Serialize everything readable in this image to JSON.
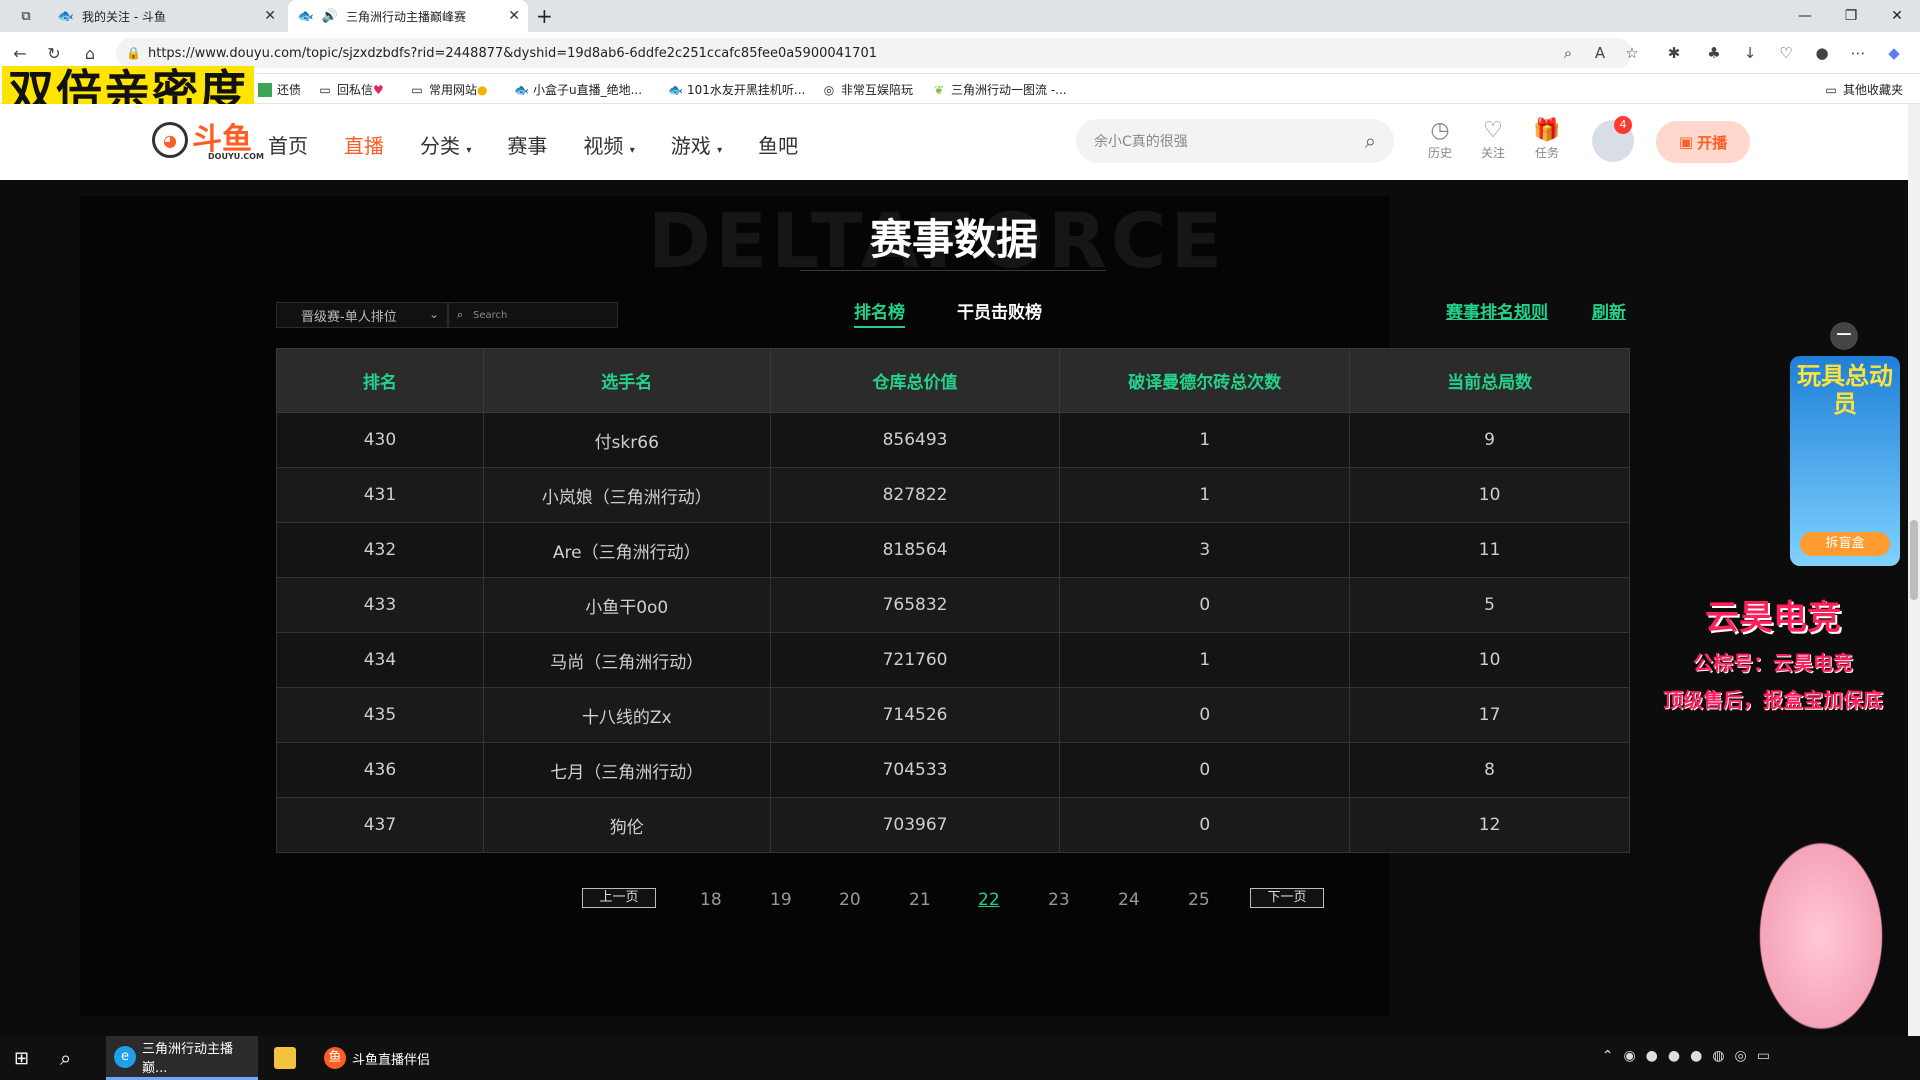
{
  "browser": {
    "tabs": [
      {
        "title": "我的关注 - 斗鱼",
        "active": false
      },
      {
        "title": "三角洲行动主播巅峰赛",
        "active": true
      }
    ],
    "new_tab": "+",
    "url": "https://www.douyu.com/topic/sjzxdzbdfs?rid=2448877&dyshid=19d8ab6-6ddfe2c251ccafc85fee0a5900041701",
    "bookmarks": [
      "还债",
      "回私信",
      "常用网站",
      "小盒子u直播_绝地...",
      "101水友开黑挂机听...",
      "非常互娱陪玩",
      "三角洲行动一图流 -..."
    ],
    "other_bookmarks": "其他收藏夹"
  },
  "overlay_caption": "双倍亲密度",
  "site": {
    "logo_text": "斗鱼",
    "logo_sub": "DOUYU.COM",
    "nav": [
      "首页",
      "直播",
      "分类",
      "赛事",
      "视频",
      "游戏",
      "鱼吧"
    ],
    "nav_active": "直播",
    "search_placeholder": "余小C真的很强",
    "header_icons": [
      "历史",
      "关注",
      "任务"
    ],
    "badge_count": "4",
    "live_button": "开播"
  },
  "page": {
    "bg_text": "DELTAFORCE",
    "title": "赛事数据",
    "filter_select": "晋级赛-单人排位",
    "search_placeholder": "Search",
    "tabs": [
      "排名榜",
      "干员击败榜"
    ],
    "links": [
      "赛事排名规则",
      "刷新"
    ]
  },
  "table": {
    "headers": [
      "排名",
      "选手名",
      "仓库总价值",
      "破译曼德尔砖总次数",
      "当前总局数"
    ],
    "rows": [
      [
        "430",
        "付skr66",
        "856493",
        "1",
        "9"
      ],
      [
        "431",
        "小岚娘（三角洲行动）",
        "827822",
        "1",
        "10"
      ],
      [
        "432",
        "Are（三角洲行动）",
        "818564",
        "3",
        "11"
      ],
      [
        "433",
        "小鱼干0o0",
        "765832",
        "0",
        "5"
      ],
      [
        "434",
        "马尚（三角洲行动）",
        "721760",
        "1",
        "10"
      ],
      [
        "435",
        "十八线的Zx",
        "714526",
        "0",
        "17"
      ],
      [
        "436",
        "七月（三角洲行动）",
        "704533",
        "0",
        "8"
      ],
      [
        "437",
        "狗伦",
        "703967",
        "0",
        "12"
      ]
    ]
  },
  "pager": {
    "prev": "上一页",
    "next": "下一页",
    "pages": [
      "18",
      "19",
      "20",
      "21",
      "22",
      "23",
      "24",
      "25"
    ],
    "current": "22"
  },
  "promo": {
    "title": "玩具总动员",
    "button": "拆盲盒"
  },
  "streamer_overlay": {
    "name": "云昊电竞",
    "line1": "公棕号：云昊电竞",
    "line2": "顶级售后，报盒宝加保底"
  },
  "taskbar": {
    "items": [
      "三角洲行动主播巅...",
      "斗鱼直播伴侣"
    ]
  }
}
